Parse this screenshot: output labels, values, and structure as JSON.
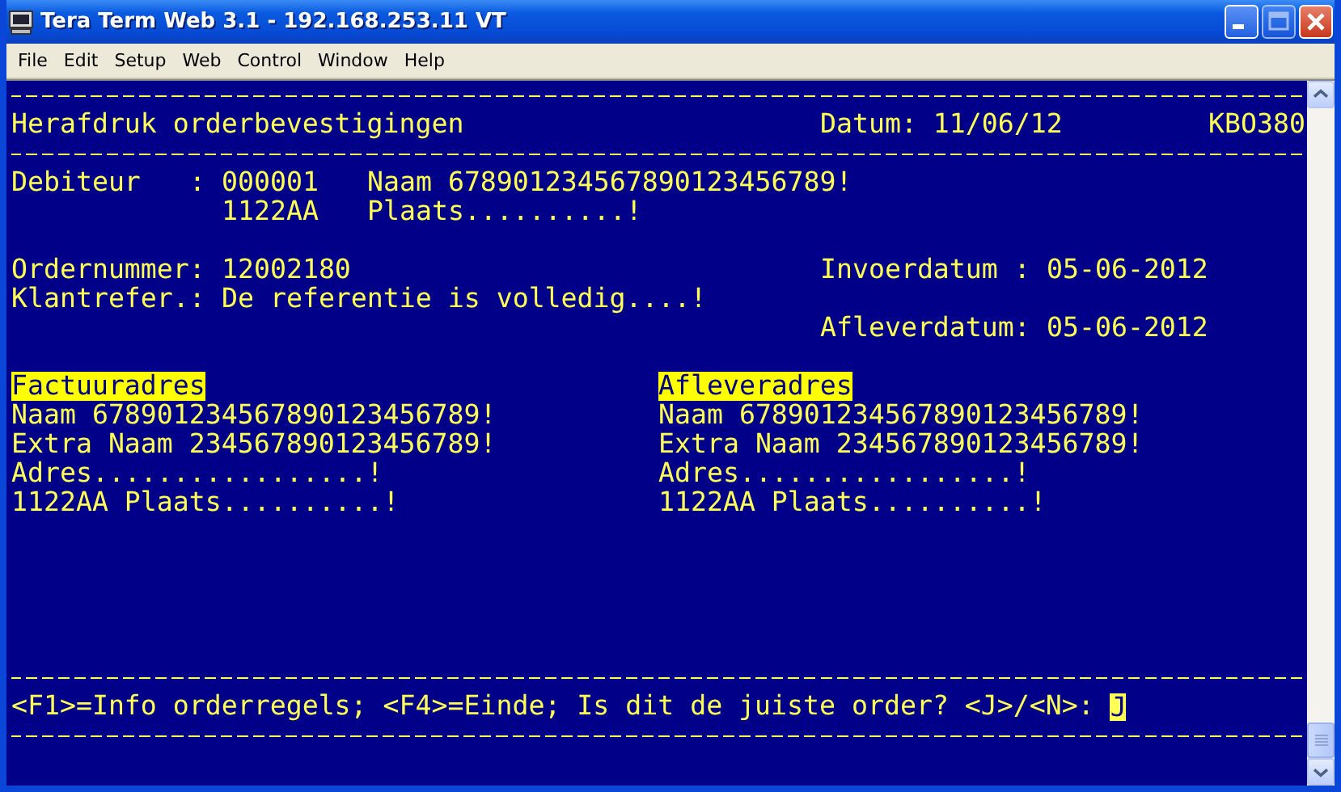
{
  "window": {
    "title": "Tera Term Web 3.1 - 192.168.253.11 VT"
  },
  "menu": [
    "File",
    "Edit",
    "Setup",
    "Web",
    "Control",
    "Window",
    "Help"
  ],
  "screen": {
    "title": "Herafdruk orderbevestigingen",
    "date": "Datum: 11/06/12",
    "program": "KBO380",
    "debtor": {
      "label": "Debiteur",
      "colon": ":",
      "number": "000001",
      "name": "Naam 678901234567890123456789!",
      "postcode": "1122AA",
      "city": "Plaats..........!"
    },
    "order": {
      "label": "Ordernummer:",
      "value": "12002180"
    },
    "reference": {
      "label": "Klantrefer.:",
      "value": "De referentie is volledig....!"
    },
    "entry_date": {
      "label": "Invoerdatum :",
      "value": "05-06-2012"
    },
    "delivery_date": {
      "label": "Afleverdatum:",
      "value": "05-06-2012"
    },
    "addresses": [
      {
        "heading": "Factuuradres",
        "lines": [
          "Naam 678901234567890123456789!",
          "Extra Naam 234567890123456789!",
          "Adres.................!",
          "1122AA Plaats..........!"
        ]
      },
      {
        "heading": "Afleveradres",
        "lines": [
          "Naam 678901234567890123456789!",
          "Extra Naam 234567890123456789!",
          "Adres.................!",
          "1122AA Plaats..........!"
        ]
      }
    ],
    "prompt": "<F1>=Info orderregels; <F4>=Einde; Is dit de juiste order? <J>/<N>:",
    "answer": "J"
  }
}
